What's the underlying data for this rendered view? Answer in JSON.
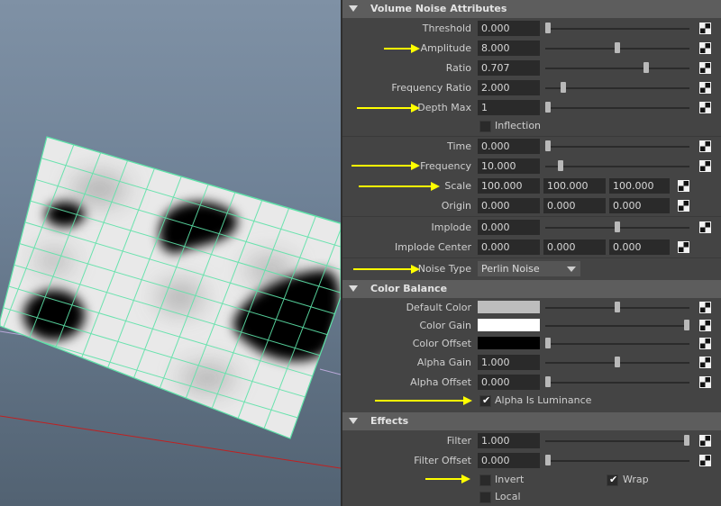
{
  "colors": {
    "highlight_arrow": "#ffff00",
    "grid_line": "#5de2a8",
    "panel_bg": "#444444",
    "header_bg": "#5d5d5d"
  },
  "viewport": {
    "name": "3d-viewport"
  },
  "sections": {
    "volume_noise": {
      "title": "Volume Noise Attributes",
      "threshold": {
        "label": "Threshold",
        "value": "0.000",
        "level": 0.0
      },
      "amplitude": {
        "label": "Amplitude",
        "value": "8.000",
        "level": 0.5
      },
      "ratio": {
        "label": "Ratio",
        "value": "0.707",
        "level": 0.707
      },
      "frequency_ratio": {
        "label": "Frequency Ratio",
        "value": "2.000",
        "level": 0.11
      },
      "depth_max": {
        "label": "Depth Max",
        "value": "1",
        "level": 0.0
      },
      "inflection": {
        "label": "Inflection",
        "checked": false
      },
      "time": {
        "label": "Time",
        "value": "0.000",
        "level": 0.0
      },
      "frequency": {
        "label": "Frequency",
        "value": "10.000",
        "level": 0.09
      },
      "scale": {
        "label": "Scale",
        "x": "100.000",
        "y": "100.000",
        "z": "100.000"
      },
      "origin": {
        "label": "Origin",
        "x": "0.000",
        "y": "0.000",
        "z": "0.000"
      },
      "implode": {
        "label": "Implode",
        "value": "0.000",
        "level": 0.5
      },
      "implode_center": {
        "label": "Implode Center",
        "x": "0.000",
        "y": "0.000",
        "z": "0.000"
      },
      "noise_type": {
        "label": "Noise Type",
        "value": "Perlin Noise"
      }
    },
    "color_balance": {
      "title": "Color Balance",
      "default_color": {
        "label": "Default Color",
        "swatch": "#bdbdbd",
        "level": 0.5
      },
      "color_gain": {
        "label": "Color Gain",
        "swatch": "#ffffff",
        "level": 1.0
      },
      "color_offset": {
        "label": "Color Offset",
        "swatch": "#000000",
        "level": 0.0
      },
      "alpha_gain": {
        "label": "Alpha Gain",
        "value": "1.000",
        "level": 0.5
      },
      "alpha_offset": {
        "label": "Alpha Offset",
        "value": "0.000",
        "level": 0.0
      },
      "alpha_is_luminance": {
        "label": "Alpha Is Luminance",
        "checked": true
      }
    },
    "effects": {
      "title": "Effects",
      "filter": {
        "label": "Filter",
        "value": "1.000",
        "level": 1.0
      },
      "filter_offset": {
        "label": "Filter Offset",
        "value": "0.000",
        "level": 0.0
      },
      "invert": {
        "label": "Invert",
        "checked": false
      },
      "wrap": {
        "label": "Wrap",
        "checked": true
      },
      "local": {
        "label": "Local",
        "checked": false
      }
    }
  }
}
